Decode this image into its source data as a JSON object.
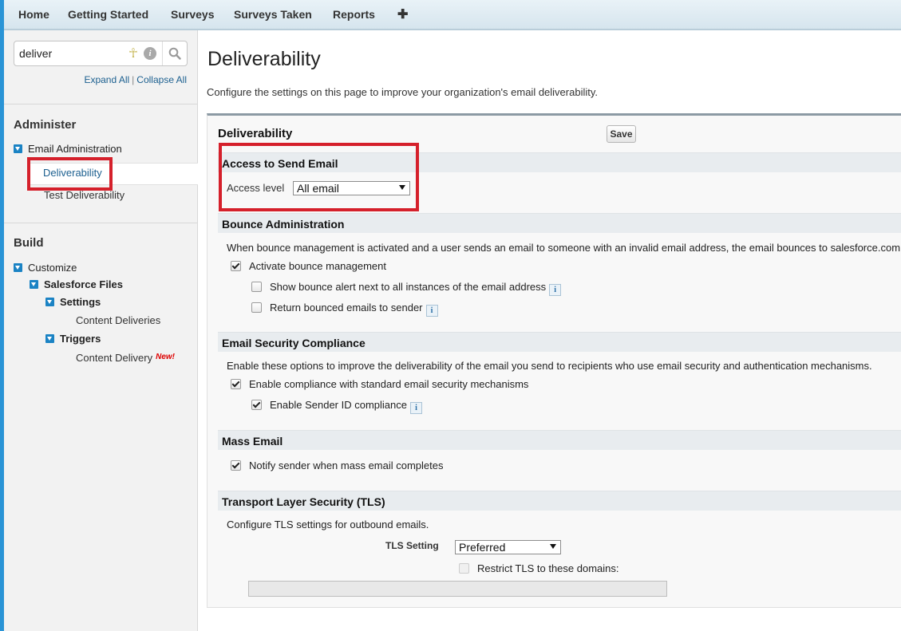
{
  "nav": {
    "items": [
      "Home",
      "Getting Started",
      "Surveys",
      "Surveys Taken",
      "Reports"
    ],
    "plus": "✚"
  },
  "sidebar": {
    "search": {
      "value": "deliver",
      "placeholder": ""
    },
    "expand_all": "Expand All",
    "separator": "|",
    "collapse_all": "Collapse All",
    "administer": {
      "heading": "Administer",
      "group": "Email Administration",
      "items": [
        "Deliverability",
        "Test Deliverability"
      ]
    },
    "build": {
      "heading": "Build",
      "customize": "Customize",
      "salesforce_files": "Salesforce Files",
      "settings": "Settings",
      "content_deliveries": "Content Deliveries",
      "triggers": "Triggers",
      "content_delivery": "Content Delivery",
      "new_badge": "New!"
    }
  },
  "main": {
    "title": "Deliverability",
    "description": "Configure the settings on this page to improve your organization's email deliverability.",
    "panel_title": "Deliverability",
    "save_label": "Save",
    "access": {
      "heading": "Access to Send Email",
      "label": "Access level",
      "value": "All email"
    },
    "bounce": {
      "heading": "Bounce Administration",
      "description": "When bounce management is activated and a user sends an email to someone with an invalid email address, the email bounces to salesforce.com",
      "activate": {
        "label": "Activate bounce management",
        "checked": true
      },
      "show_alert": {
        "label": "Show bounce alert next to all instances of the email address",
        "checked": false
      },
      "return_emails": {
        "label": "Return bounced emails to sender",
        "checked": false
      }
    },
    "security": {
      "heading": "Email Security Compliance",
      "description": "Enable these options to improve the deliverability of the email you send to recipients who use email security and authentication mechanisms.",
      "standard": {
        "label": "Enable compliance with standard email security mechanisms",
        "checked": true
      },
      "sender_id": {
        "label": "Enable Sender ID compliance",
        "checked": true
      }
    },
    "mass": {
      "heading": "Mass Email",
      "notify": {
        "label": "Notify sender when mass email completes",
        "checked": true
      }
    },
    "tls": {
      "heading": "Transport Layer Security (TLS)",
      "description": "Configure TLS settings for outbound emails.",
      "setting_label": "TLS Setting",
      "setting_value": "Preferred",
      "restrict": {
        "label": "Restrict TLS to these domains:",
        "checked": false
      }
    }
  },
  "colors": {
    "accent": "#2a94d6",
    "highlight_box": "#d5202b",
    "link": "#1b5f8f"
  },
  "icons": [
    "pin-icon",
    "info-icon",
    "search-icon",
    "expand-toggle-icon",
    "info-square-icon"
  ]
}
